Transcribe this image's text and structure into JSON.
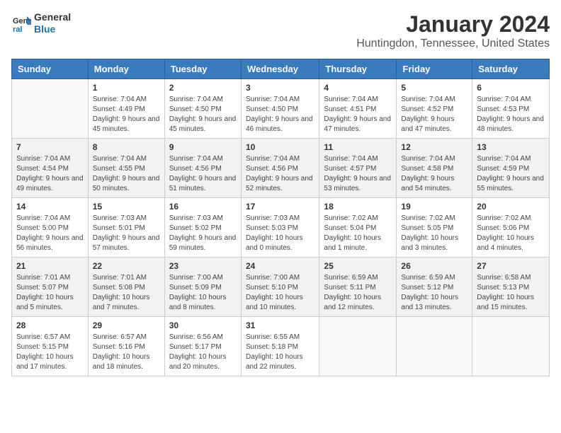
{
  "header": {
    "logo_line1": "General",
    "logo_line2": "Blue",
    "title": "January 2024",
    "subtitle": "Huntingdon, Tennessee, United States"
  },
  "columns": [
    "Sunday",
    "Monday",
    "Tuesday",
    "Wednesday",
    "Thursday",
    "Friday",
    "Saturday"
  ],
  "weeks": [
    [
      {
        "num": "",
        "sunrise": "",
        "sunset": "",
        "daylight": ""
      },
      {
        "num": "1",
        "sunrise": "Sunrise: 7:04 AM",
        "sunset": "Sunset: 4:49 PM",
        "daylight": "Daylight: 9 hours and 45 minutes."
      },
      {
        "num": "2",
        "sunrise": "Sunrise: 7:04 AM",
        "sunset": "Sunset: 4:50 PM",
        "daylight": "Daylight: 9 hours and 45 minutes."
      },
      {
        "num": "3",
        "sunrise": "Sunrise: 7:04 AM",
        "sunset": "Sunset: 4:50 PM",
        "daylight": "Daylight: 9 hours and 46 minutes."
      },
      {
        "num": "4",
        "sunrise": "Sunrise: 7:04 AM",
        "sunset": "Sunset: 4:51 PM",
        "daylight": "Daylight: 9 hours and 47 minutes."
      },
      {
        "num": "5",
        "sunrise": "Sunrise: 7:04 AM",
        "sunset": "Sunset: 4:52 PM",
        "daylight": "Daylight: 9 hours and 47 minutes."
      },
      {
        "num": "6",
        "sunrise": "Sunrise: 7:04 AM",
        "sunset": "Sunset: 4:53 PM",
        "daylight": "Daylight: 9 hours and 48 minutes."
      }
    ],
    [
      {
        "num": "7",
        "sunrise": "Sunrise: 7:04 AM",
        "sunset": "Sunset: 4:54 PM",
        "daylight": "Daylight: 9 hours and 49 minutes."
      },
      {
        "num": "8",
        "sunrise": "Sunrise: 7:04 AM",
        "sunset": "Sunset: 4:55 PM",
        "daylight": "Daylight: 9 hours and 50 minutes."
      },
      {
        "num": "9",
        "sunrise": "Sunrise: 7:04 AM",
        "sunset": "Sunset: 4:56 PM",
        "daylight": "Daylight: 9 hours and 51 minutes."
      },
      {
        "num": "10",
        "sunrise": "Sunrise: 7:04 AM",
        "sunset": "Sunset: 4:56 PM",
        "daylight": "Daylight: 9 hours and 52 minutes."
      },
      {
        "num": "11",
        "sunrise": "Sunrise: 7:04 AM",
        "sunset": "Sunset: 4:57 PM",
        "daylight": "Daylight: 9 hours and 53 minutes."
      },
      {
        "num": "12",
        "sunrise": "Sunrise: 7:04 AM",
        "sunset": "Sunset: 4:58 PM",
        "daylight": "Daylight: 9 hours and 54 minutes."
      },
      {
        "num": "13",
        "sunrise": "Sunrise: 7:04 AM",
        "sunset": "Sunset: 4:59 PM",
        "daylight": "Daylight: 9 hours and 55 minutes."
      }
    ],
    [
      {
        "num": "14",
        "sunrise": "Sunrise: 7:04 AM",
        "sunset": "Sunset: 5:00 PM",
        "daylight": "Daylight: 9 hours and 56 minutes."
      },
      {
        "num": "15",
        "sunrise": "Sunrise: 7:03 AM",
        "sunset": "Sunset: 5:01 PM",
        "daylight": "Daylight: 9 hours and 57 minutes."
      },
      {
        "num": "16",
        "sunrise": "Sunrise: 7:03 AM",
        "sunset": "Sunset: 5:02 PM",
        "daylight": "Daylight: 9 hours and 59 minutes."
      },
      {
        "num": "17",
        "sunrise": "Sunrise: 7:03 AM",
        "sunset": "Sunset: 5:03 PM",
        "daylight": "Daylight: 10 hours and 0 minutes."
      },
      {
        "num": "18",
        "sunrise": "Sunrise: 7:02 AM",
        "sunset": "Sunset: 5:04 PM",
        "daylight": "Daylight: 10 hours and 1 minute."
      },
      {
        "num": "19",
        "sunrise": "Sunrise: 7:02 AM",
        "sunset": "Sunset: 5:05 PM",
        "daylight": "Daylight: 10 hours and 3 minutes."
      },
      {
        "num": "20",
        "sunrise": "Sunrise: 7:02 AM",
        "sunset": "Sunset: 5:06 PM",
        "daylight": "Daylight: 10 hours and 4 minutes."
      }
    ],
    [
      {
        "num": "21",
        "sunrise": "Sunrise: 7:01 AM",
        "sunset": "Sunset: 5:07 PM",
        "daylight": "Daylight: 10 hours and 5 minutes."
      },
      {
        "num": "22",
        "sunrise": "Sunrise: 7:01 AM",
        "sunset": "Sunset: 5:08 PM",
        "daylight": "Daylight: 10 hours and 7 minutes."
      },
      {
        "num": "23",
        "sunrise": "Sunrise: 7:00 AM",
        "sunset": "Sunset: 5:09 PM",
        "daylight": "Daylight: 10 hours and 8 minutes."
      },
      {
        "num": "24",
        "sunrise": "Sunrise: 7:00 AM",
        "sunset": "Sunset: 5:10 PM",
        "daylight": "Daylight: 10 hours and 10 minutes."
      },
      {
        "num": "25",
        "sunrise": "Sunrise: 6:59 AM",
        "sunset": "Sunset: 5:11 PM",
        "daylight": "Daylight: 10 hours and 12 minutes."
      },
      {
        "num": "26",
        "sunrise": "Sunrise: 6:59 AM",
        "sunset": "Sunset: 5:12 PM",
        "daylight": "Daylight: 10 hours and 13 minutes."
      },
      {
        "num": "27",
        "sunrise": "Sunrise: 6:58 AM",
        "sunset": "Sunset: 5:13 PM",
        "daylight": "Daylight: 10 hours and 15 minutes."
      }
    ],
    [
      {
        "num": "28",
        "sunrise": "Sunrise: 6:57 AM",
        "sunset": "Sunset: 5:15 PM",
        "daylight": "Daylight: 10 hours and 17 minutes."
      },
      {
        "num": "29",
        "sunrise": "Sunrise: 6:57 AM",
        "sunset": "Sunset: 5:16 PM",
        "daylight": "Daylight: 10 hours and 18 minutes."
      },
      {
        "num": "30",
        "sunrise": "Sunrise: 6:56 AM",
        "sunset": "Sunset: 5:17 PM",
        "daylight": "Daylight: 10 hours and 20 minutes."
      },
      {
        "num": "31",
        "sunrise": "Sunrise: 6:55 AM",
        "sunset": "Sunset: 5:18 PM",
        "daylight": "Daylight: 10 hours and 22 minutes."
      },
      {
        "num": "",
        "sunrise": "",
        "sunset": "",
        "daylight": ""
      },
      {
        "num": "",
        "sunrise": "",
        "sunset": "",
        "daylight": ""
      },
      {
        "num": "",
        "sunrise": "",
        "sunset": "",
        "daylight": ""
      }
    ]
  ]
}
